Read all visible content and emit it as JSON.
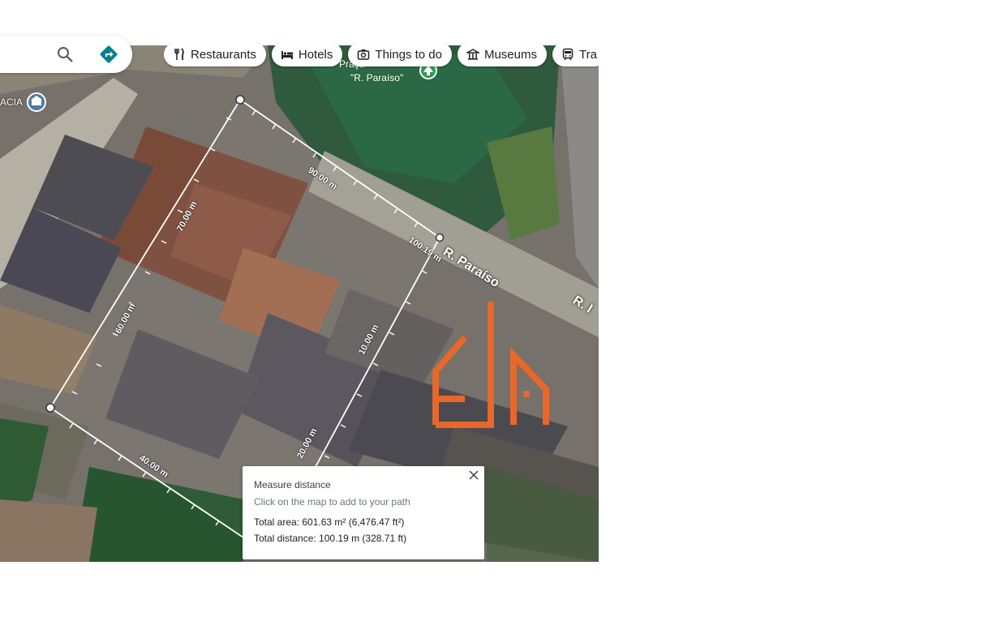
{
  "search": {
    "search_icon": "search-icon",
    "directions_icon": "directions-icon"
  },
  "chips": [
    {
      "label": "Restaurants",
      "icon": "fork-knife-icon"
    },
    {
      "label": "Hotels",
      "icon": "bed-icon"
    },
    {
      "label": "Things to do",
      "icon": "camera-icon"
    },
    {
      "label": "Museums",
      "icon": "museum-icon"
    },
    {
      "label": "Tra",
      "icon": "train-icon"
    }
  ],
  "map_labels": {
    "place_name": "\"R. Paraíso\"",
    "place_prefix": "Praça",
    "left_place": "ACIA",
    "road_1": "R. Paraíso",
    "road_2": "R. I"
  },
  "segment_labels": {
    "top": "90.00 m",
    "top_right": "100.19 m",
    "left_upper": "70.00 m",
    "left_lower": "60.00 m",
    "right_middle": "10.00 m",
    "right_lower": "20.00 m",
    "bottom": "40.00 m"
  },
  "measure_card": {
    "title": "Measure distance",
    "hint": "Click on the map to add to your path",
    "total_area": "Total area: 601.63 m² (6,476.47 ft²)",
    "total_distance": "Total distance: 100.19 m (328.71 ft)"
  },
  "colors": {
    "accent": "#e8672a",
    "directions": "#00838f",
    "measure_line": "#ffffff"
  }
}
